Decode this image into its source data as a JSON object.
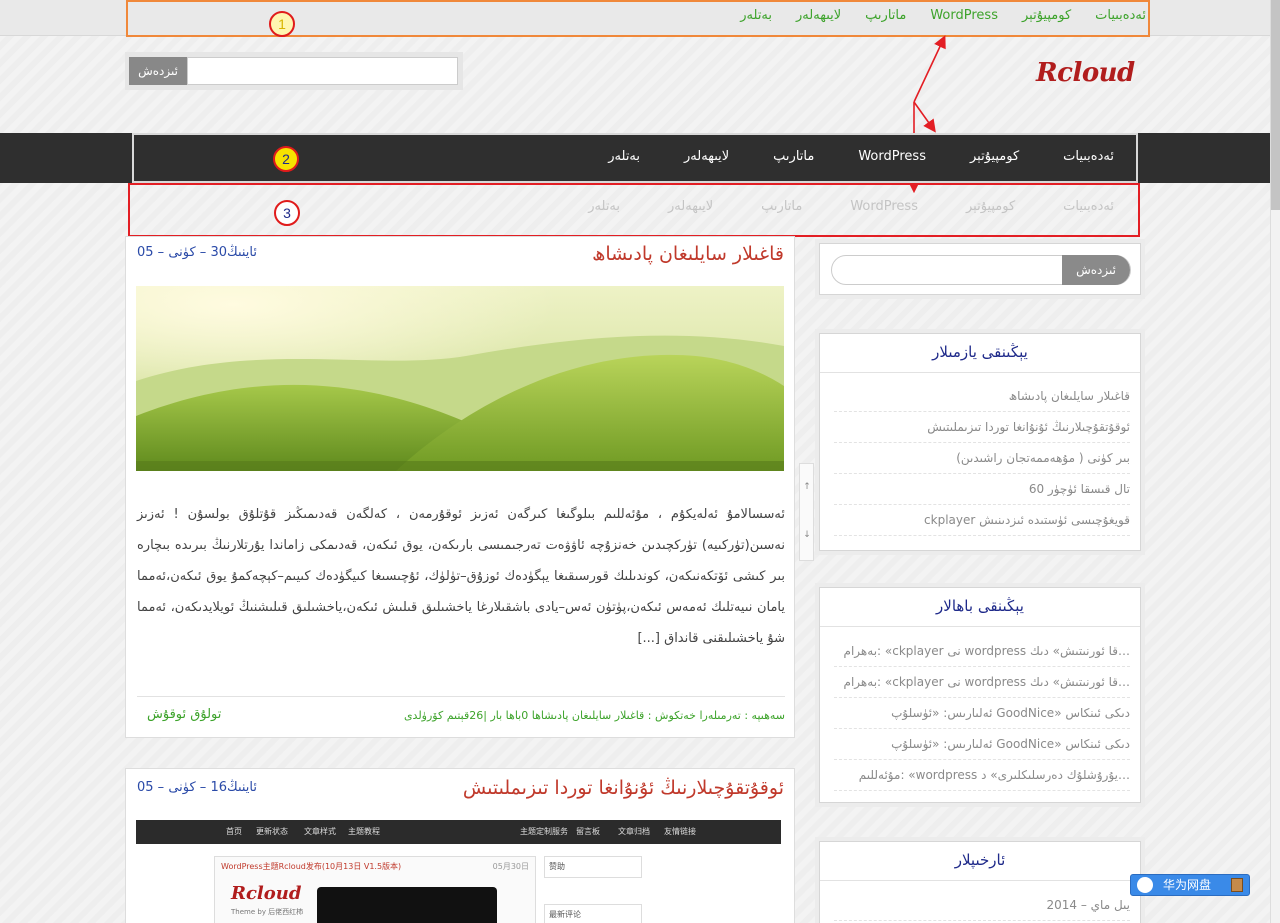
{
  "top_nav": {
    "items": [
      "ئەدەبىيات",
      "كومپيۇتېر",
      "WordPress",
      "ماتارىپ",
      "لايىھەلەر",
      "بەتلەر"
    ],
    "marker": "1"
  },
  "header": {
    "search_button": "ئىزدەش",
    "search_placeholder": "",
    "logo": "Rcloud"
  },
  "main_nav": {
    "items": [
      "ئەدەبىيات",
      "كومپيۇتېر",
      "WordPress",
      "ماتارىپ",
      "لايىھەلەر",
      "بەتلەر"
    ],
    "marker": "2"
  },
  "sub_nav": {
    "items": [
      "ئەدەبىيات",
      "كومپيۇتېر",
      "WordPress",
      "ماتارىپ",
      "لايىھەلەر",
      "بەتلەر"
    ],
    "marker": "3"
  },
  "posts": [
    {
      "title": "قاغىلار سايلىغان پادىشاھ",
      "date": "05 – ئاينىڭ30 – كۈنى",
      "excerpt": "ئەسسالامۇ ئەلەيكۇم ، مۇئەللىم بىلوگىغا كىرگەن ئەزىز ئوقۇرمەن ، كەلگەن قەدىمىڭىز قۇتلۇق بولسۇن ! ئەزىز نەسىن(تۈركىيە) تۈركچىدىن خەنزۇچە ئاۋۋەت تەرجىمىسى بارىكەن، يوق ئىكەن، قەدىمكى زاماندا يۇرتلارنىڭ بىرىدە بىچارە بىر كىشى ئۆتكەنىكەن، كوندىلىك قورسىقىغا يېگۈدەك ئوزۇق–تۈلۈك، ئۇچىسىغا كىيگۈدەك كىيىم–كېچەكمۇ يوق ئىكەن،ئەمما يامان نىيەتلىك ئەمەس ئىكەن،پۈتۈن ئەس–يادى باشقىلارغا ياخشىلىق قىلىش ئىكەن،ياخشىلىق قىلىشنىڭ ئويلايدىكەن، ئەمما شۇ ياخشىلىقنى قانداق [...]",
      "meta": "سەھىپە : تەرمىلەرا خەتكوش : قاغىلار سايلىغان پادىشاھا 0باھا بار |26قېتىم كۆرۈلدى",
      "more": "تولۇق ئوقۇش"
    },
    {
      "title": "ئوقۇتقۇچىلارنىڭ ئۇنۇانغا توردا تىزىملىتىش",
      "date": "05 – ئاينىڭ16 – كۈنى"
    }
  ],
  "sidebar": {
    "search_button": "ئىزدەش",
    "recent_title": "يېڭىنقى يازمىلار",
    "recent_posts": [
      "قاغىلار سايلىغان پادىشاھ",
      "ئوقۇتقۇچىلارنىڭ ئۇنۇانغا توردا تىزىملىتىش",
      "بىر كۈنى ( مۇھەممەتجان راشىدىن)",
      "60 تال قىسقا ئۈچۈر",
      "ckplayer قويغۇچىسى ئۈستىدە ئىزدىنىش"
    ],
    "comments_title": "يېڭىنقى باھالار",
    "recent_comments": [
      "بەھرام: «ckplayer نى wordpress قا ئورنىتىش» دىك…",
      "بەھرام: «ckplayer نى wordpress قا ئورنىتىش» دىك…",
      "ئەلىارىس: «ئۈسلۇپ GoodNice» دىكى ئىنكاس",
      "ئەلىارىس: «ئۈسلۇپ GoodNice» دىكى ئىنكاس",
      "مۇئەللىم: «wordpress يۇرۇشلۇك دەرسلىكلىرى» د…"
    ],
    "archive_title": "ئارخىپلار",
    "archives": [
      "2014 – يىل ماي"
    ]
  },
  "scroll_control": {
    "up": "↑",
    "down": "↓"
  },
  "cloud_widget": {
    "label": "华为网盘"
  },
  "thumbnail_screenshot": {
    "nav": [
      "首页",
      "更新状态",
      "文章样式",
      "主题教程",
      "主题定制服务",
      "留言板",
      "文章归档",
      "友情链接"
    ],
    "card_title": "WordPress主题Rcloud发布(10月13日 V1.5版本)",
    "card_date": "05月30日",
    "card_logo": "Rcloud",
    "card_sub": "Theme by 后佬西红柿",
    "side_1": "赞助",
    "side_2": "最新评论"
  },
  "colors": {
    "accent_green": "#3da32b",
    "title_red": "#c0392b",
    "link_blue": "#2a4aa8",
    "nav_dark": "#2f2f2f",
    "annotation_red": "#e31e24",
    "annotation_orange": "#f0883a"
  }
}
